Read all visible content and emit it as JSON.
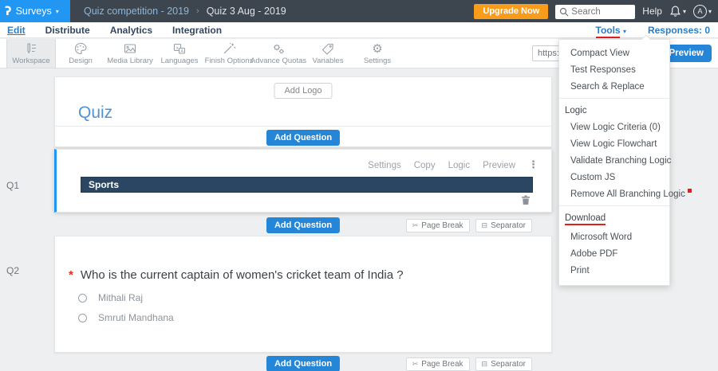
{
  "colors": {
    "accent_blue": "#2196f3",
    "button_blue": "#2586d7",
    "upgrade_orange": "#f99c1b",
    "topbar_dark": "#3d464f",
    "section_navy": "#2a4663",
    "annotation_red": "#e01f1f",
    "required_red": "#e0301e"
  },
  "icons": {
    "caret_down": "▾",
    "breadcrumb_sep": "›",
    "dots_vertical": "⋮",
    "scissors": "✂",
    "separator_box": "⊟",
    "gear": "⚙"
  },
  "topbar": {
    "logo_glyph": "ʔ",
    "product": "Surveys",
    "breadcrumb_parent": "Quiz competition - 2019",
    "breadcrumb_current": "Quiz 3 Aug - 2019",
    "upgrade_label": "Upgrade Now",
    "search_placeholder": "Search",
    "help_label": "Help",
    "avatar_letter": "A"
  },
  "nav": {
    "items": [
      {
        "label": "Edit"
      },
      {
        "label": "Distribute"
      },
      {
        "label": "Analytics"
      },
      {
        "label": "Integration"
      }
    ],
    "tools_label": "Tools",
    "responses_label": "Responses: 0"
  },
  "toolbar": {
    "items": [
      {
        "label": "Workspace"
      },
      {
        "label": "Design"
      },
      {
        "label": "Media Library"
      },
      {
        "label": "Languages"
      },
      {
        "label": "Finish Options"
      },
      {
        "label": "Advance Quotas"
      },
      {
        "label": "Variables"
      },
      {
        "label": "Settings"
      }
    ],
    "url_value": "https://",
    "preview_label": "Preview"
  },
  "survey": {
    "add_logo_label": "Add Logo",
    "title": "Quiz",
    "add_question_label": "Add Question",
    "page_break_label": "Page Break",
    "separator_label": "Separator",
    "q1": {
      "id": "Q1",
      "actions": [
        {
          "label": "Settings"
        },
        {
          "label": "Copy"
        },
        {
          "label": "Logic"
        },
        {
          "label": "Preview"
        }
      ],
      "section_title": "Sports"
    },
    "q2": {
      "id": "Q2",
      "required_marker": "*",
      "question": "Who is the current captain of women's cricket team of India ?",
      "options": [
        {
          "label": "Mithali Raj"
        },
        {
          "label": "Smruti Mandhana"
        }
      ]
    }
  },
  "tools_menu": {
    "items_top": [
      {
        "label": "Compact View"
      },
      {
        "label": "Test Responses"
      },
      {
        "label": "Search & Replace"
      }
    ],
    "logic_header": "Logic",
    "logic_items": [
      {
        "label": "View Logic Criteria (0)"
      },
      {
        "label": "View Logic Flowchart"
      },
      {
        "label": "Validate Branching Logic"
      },
      {
        "label": "Custom JS"
      },
      {
        "label": "Remove All Branching Logic"
      }
    ],
    "download_header": "Download",
    "download_items": [
      {
        "label": "Microsoft Word"
      },
      {
        "label": "Adobe PDF"
      },
      {
        "label": "Print"
      }
    ]
  }
}
